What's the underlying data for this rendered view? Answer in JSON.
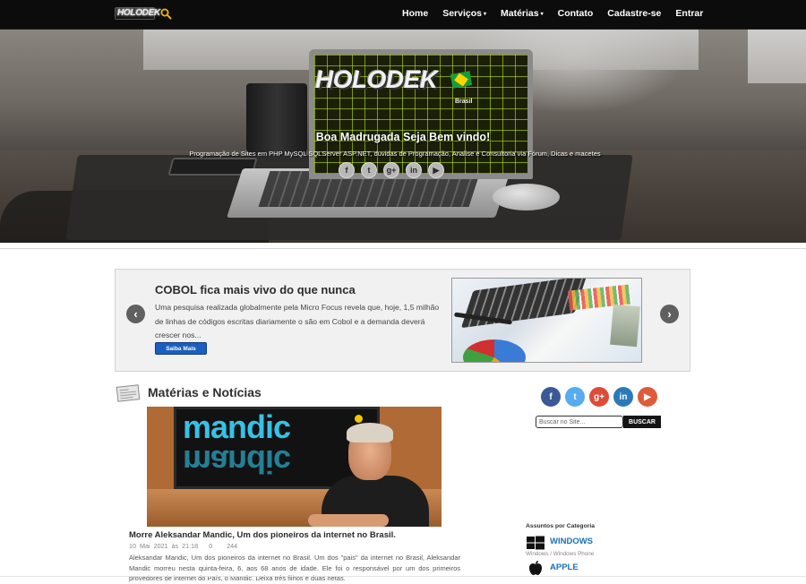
{
  "header": {
    "logo_text": "HOLODEK",
    "nav": [
      {
        "label": "Home",
        "caret": ""
      },
      {
        "label": "Serviços",
        "caret": "▾"
      },
      {
        "label": "Matérias",
        "caret": "▾"
      },
      {
        "label": "Contato",
        "caret": ""
      },
      {
        "label": "Cadastre-se",
        "caret": ""
      },
      {
        "label": "Entrar",
        "caret": ""
      }
    ],
    "search_icon": "search-icon",
    "search_icon_color": "#f0b400"
  },
  "hero": {
    "logo_text": "HOLODEK",
    "logo_sub": "Brasil",
    "title": "Boa Madrugada Seja Bem vindo!",
    "subtitle": "Programação de Sites em PHP MySQL SQLServer ASP.NET, duvidas de Programação, Analise e Consultoria via Fórum, Dicas e macetes",
    "social": [
      {
        "icon": "facebook-icon",
        "glyph": "f"
      },
      {
        "icon": "twitter-icon",
        "glyph": "t"
      },
      {
        "icon": "google-plus-icon",
        "glyph": "g+"
      },
      {
        "icon": "linkedin-icon",
        "glyph": "in"
      },
      {
        "icon": "youtube-icon",
        "glyph": "▶"
      }
    ]
  },
  "carousel": {
    "title": "COBOL fica mais vivo do que nunca",
    "text": "Uma pesquisa realizada globalmente pela Micro Focus revela que, hoje, 1,5 milhão de linhas de códigos escritas diariamente o são em Cobol e a demanda deverá crescer nos...",
    "button": "Saiba Mais",
    "prev": "‹",
    "next": "›"
  },
  "section": {
    "title": "Matérias e Notícias"
  },
  "article": {
    "image_brand": "mandic",
    "title": "Morre Aleksandar Mandic, Um dos pioneiros da internet no Brasil.",
    "date": "10 Mai 2021 às 21:18",
    "comments": "0",
    "views": "244",
    "text": "Aleksandar Mandic, Um dos pioneiros da internet no Brasil. Um dos \"pais\" da internet no Brasil, Aleksandar Mandic morreu nesta quinta-feira, 6, aos 68 anos de idade. Ele foi o responsável por um dos primeiros provedores de internet do País, o Mandic. Deixa três filhos e duas netas."
  },
  "sidebar": {
    "social": [
      {
        "icon": "facebook-icon",
        "glyph": "f",
        "color": "#3b5998"
      },
      {
        "icon": "twitter-icon",
        "glyph": "t",
        "color": "#55acee"
      },
      {
        "icon": "google-plus-icon",
        "glyph": "g+",
        "color": "#dd4b39"
      },
      {
        "icon": "linkedin-icon",
        "glyph": "in",
        "color": "#2b7bb9"
      },
      {
        "icon": "youtube-icon",
        "glyph": "▶",
        "color": "#e05a3a"
      }
    ],
    "search_placeholder": "Buscar no Site...",
    "search_button": "BUSCAR",
    "categories_heading": "Assuntos por Categoria",
    "categories": [
      {
        "label": "WINDOWS",
        "sub": "Windows / Windows Phone",
        "icon": "windows-icon"
      },
      {
        "label": "APPLE",
        "sub": "",
        "icon": "apple-icon"
      }
    ]
  }
}
